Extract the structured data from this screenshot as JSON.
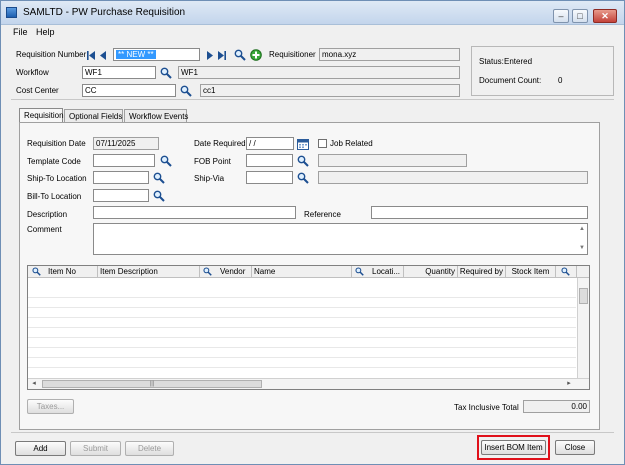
{
  "window": {
    "title": "SAMLTD - PW Purchase Requisition"
  },
  "menu": [
    "File",
    "Help"
  ],
  "header": {
    "requisition_number_label": "Requisition Number",
    "requisition_number_value": "** NEW **",
    "requisitioner_label": "Requisitioner",
    "requisitioner_value": "mona.xyz",
    "workflow_label": "Workflow",
    "workflow_code": "WF1",
    "workflow_desc": "WF1",
    "cost_center_label": "Cost Center",
    "cost_center_code": "CC",
    "cost_center_desc": "cc1",
    "status_label": "Status:",
    "status_value": "Entered",
    "doc_count_label": "Document Count:",
    "doc_count_value": "0"
  },
  "tabs": [
    "Requisition",
    "Optional Fields",
    "Workflow Events"
  ],
  "form": {
    "req_date_label": "Requisition Date",
    "req_date_value": "07/11/2025",
    "date_required_label": "Date Required",
    "date_required_value": "/ /",
    "job_related_label": "Job Related",
    "template_code_label": "Template Code",
    "fob_point_label": "FOB Point",
    "ship_to_label": "Ship-To Location",
    "ship_via_label": "Ship-Via",
    "bill_to_label": "Bill-To Location",
    "description_label": "Description",
    "reference_label": "Reference",
    "comment_label": "Comment"
  },
  "grid": {
    "columns": [
      "Item No",
      "Item Description",
      "Vendor",
      "Name",
      "Locati...",
      "Quantity",
      "Required by",
      "Stock Item"
    ]
  },
  "footer": {
    "taxes_label": "Taxes...",
    "tax_inclusive_label": "Tax Inclusive Total",
    "tax_inclusive_value": "0.00",
    "add_label": "Add",
    "submit_label": "Submit",
    "delete_label": "Delete",
    "insert_bom_label": "Insert BOM Item",
    "close_label": "Close"
  },
  "icons": {
    "finder": "magnifier-icon",
    "new": "green-plus-icon",
    "calendar": "calendar-icon"
  },
  "colors": {
    "highlight": "#e0101a",
    "selection": "#3399ff"
  }
}
